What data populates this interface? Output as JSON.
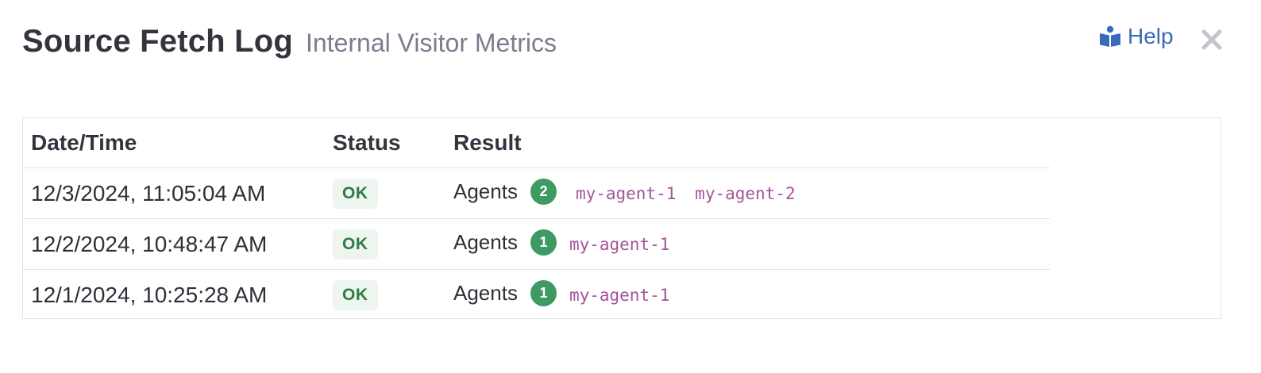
{
  "header": {
    "title": "Source Fetch Log",
    "subtitle": "Internal Visitor Metrics"
  },
  "help": {
    "label": "Help",
    "icon": "book-reader-icon"
  },
  "close": {
    "icon": "close-icon"
  },
  "table": {
    "columns": [
      "Date/Time",
      "Status",
      "Result"
    ],
    "rows": [
      {
        "datetime": "12/3/2024, 11:05:04 AM",
        "status": "OK",
        "result_label": "Agents",
        "count": "2",
        "agents": [
          "my-agent-1",
          "my-agent-2"
        ]
      },
      {
        "datetime": "12/2/2024, 10:48:47 AM",
        "status": "OK",
        "result_label": "Agents",
        "count": "1",
        "agents": [
          "my-agent-1"
        ]
      },
      {
        "datetime": "12/1/2024, 10:25:28 AM",
        "status": "OK",
        "result_label": "Agents",
        "count": "1",
        "agents": [
          "my-agent-1"
        ]
      }
    ]
  },
  "colors": {
    "link": "#3a6ab8",
    "status_ok_text": "#2f7a45",
    "status_ok_bg": "#eef5ee",
    "count_badge": "#3e9a62",
    "agent_tag": "#a4549a"
  }
}
